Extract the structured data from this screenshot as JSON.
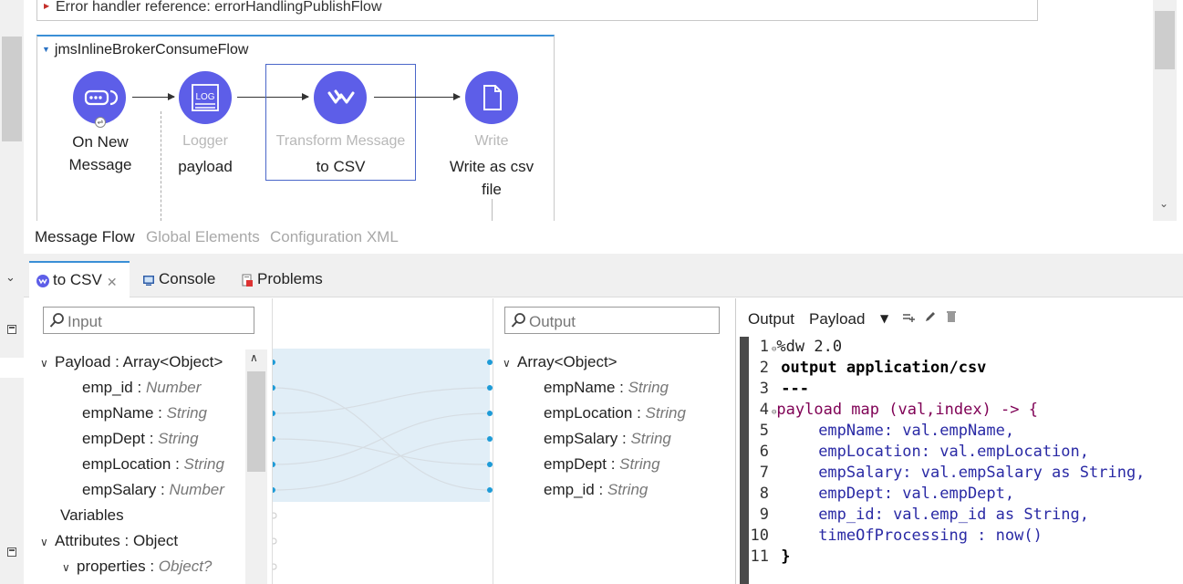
{
  "canvas": {
    "error_handler_text": "Error handler reference: errorHandlingPublishFlow",
    "flow_name": "jmsInlineBrokerConsumeFlow",
    "nodes": [
      {
        "type": "",
        "label": "On New Message",
        "icon": "jms-connector-icon"
      },
      {
        "type": "Logger",
        "label": "payload",
        "icon": "log-icon"
      },
      {
        "type": "Transform Message",
        "label": "to CSV",
        "icon": "dataweave-icon"
      },
      {
        "type": "Write",
        "label": "Write as csv file",
        "icon": "file-icon"
      }
    ],
    "node_color": "#5d5ee8",
    "tabs": [
      "Message Flow",
      "Global Elements",
      "Configuration XML"
    ]
  },
  "panel": {
    "tabs": [
      {
        "label": "to CSV",
        "icon": "dataweave-icon"
      },
      {
        "label": "Console",
        "icon": "console-icon"
      },
      {
        "label": "Problems",
        "icon": "problems-icon"
      }
    ]
  },
  "input": {
    "search_placeholder": "Input",
    "tree": [
      {
        "name": "Payload",
        "type": "Array<Object>",
        "caret": "open"
      },
      {
        "name": "emp_id",
        "type": "Number"
      },
      {
        "name": "empName",
        "type": "String"
      },
      {
        "name": "empDept",
        "type": "String"
      },
      {
        "name": "empLocation",
        "type": "String"
      },
      {
        "name": "empSalary",
        "type": "Number"
      },
      {
        "name": "Variables",
        "type": ""
      },
      {
        "name": "Attributes",
        "type": "Object",
        "caret": "open"
      },
      {
        "name": "properties",
        "type": "Object?",
        "caret": "open"
      }
    ]
  },
  "output": {
    "search_placeholder": "Output",
    "tree": [
      {
        "name": "",
        "type": "Array<Object>",
        "caret": "open"
      },
      {
        "name": "empName",
        "type": "String"
      },
      {
        "name": "empLocation",
        "type": "String"
      },
      {
        "name": "empSalary",
        "type": "String"
      },
      {
        "name": "empDept",
        "type": "String"
      },
      {
        "name": "emp_id",
        "type": "String"
      }
    ]
  },
  "script": {
    "toolbar_output": "Output",
    "toolbar_payload": "Payload",
    "lines": [
      "%dw 2.0",
      "output application/csv",
      "---",
      "payload map (val,index) -> {",
      "    empName: val.empName,",
      "    empLocation: val.empLocation,",
      "    empSalary: val.empSalary as String,",
      "    empDept: val.empDept,",
      "    emp_id: val.emp_id as String,",
      "    timeOfProcessing : now()",
      "}"
    ]
  }
}
